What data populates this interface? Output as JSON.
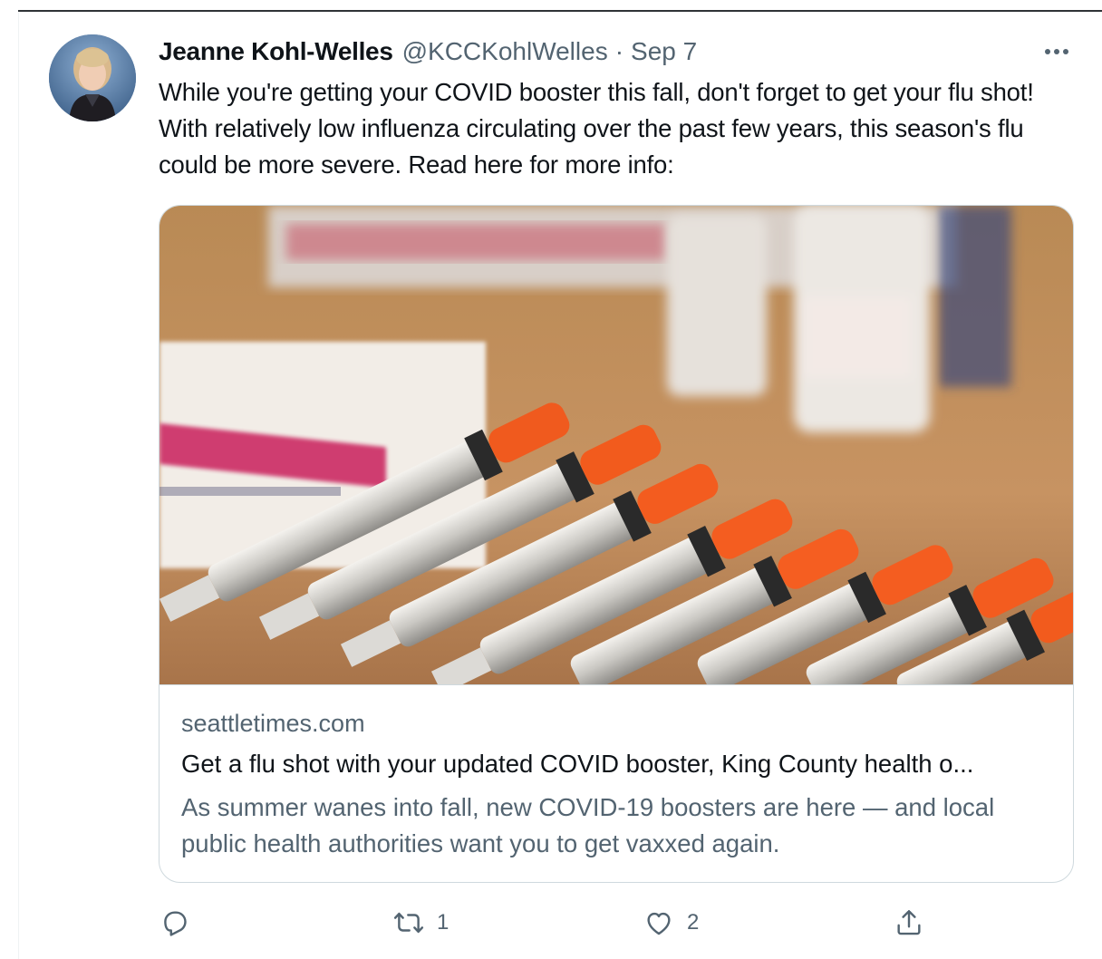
{
  "tweet": {
    "author_name": "Jeanne Kohl-Welles",
    "handle": "@KCCKohlWelles",
    "separator": "·",
    "date": "Sep 7",
    "text": "While you're getting your COVID booster this fall, don't forget to get your flu shot! With relatively low influenza circulating over the past few years, this season's flu could be more severe. Read here for more info:"
  },
  "card": {
    "image_icon": "syringes-photo",
    "domain": "seattletimes.com",
    "title": "Get a flu shot with your updated COVID booster, King County health o...",
    "description": "As summer wanes into fall, new COVID-19 boosters are here — and local public health authorities want you to get vaxxed again."
  },
  "actions": {
    "reply_icon": "reply-icon",
    "retweet_icon": "retweet-icon",
    "retweet_count": "1",
    "like_icon": "heart-icon",
    "like_count": "2",
    "share_icon": "share-icon"
  },
  "colors": {
    "text_primary": "#0f1419",
    "text_secondary": "#536471",
    "border": "#cfd9de"
  }
}
